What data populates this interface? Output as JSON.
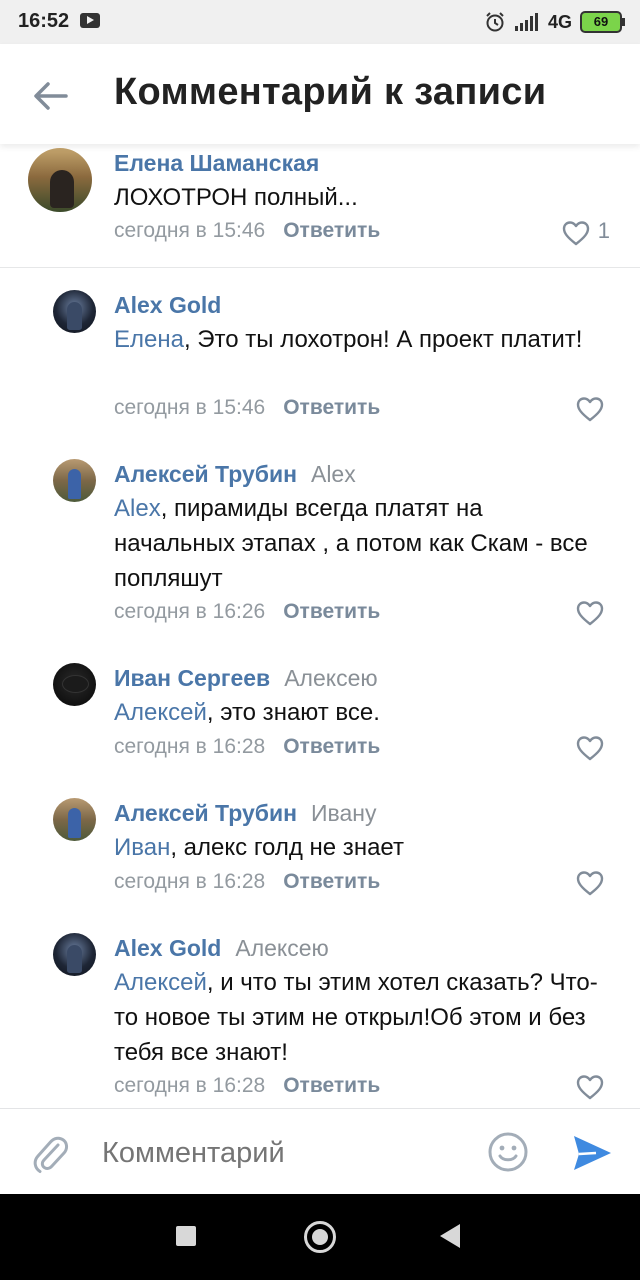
{
  "status_bar": {
    "time": "16:52",
    "network": "4G",
    "battery": "69"
  },
  "header": {
    "title": "Комментарий к записи"
  },
  "comments": [
    {
      "author": "Елена Шаманская",
      "text": "ЛОХОТРОН полный...",
      "time": "сегодня в 15:46",
      "reply_label": "Ответить",
      "likes": "1"
    },
    {
      "author": "Alex Gold",
      "mention": "Елена",
      "text": ", Это ты лохотрон! А проект платит!",
      "time": "сегодня в 15:46",
      "reply_label": "Ответить"
    },
    {
      "author": "Алексей Трубин",
      "reply_to": "Alex",
      "mention": "Alex",
      "text": ", пирамиды всегда платят на начальных этапах , а потом как Скам - все попляшут",
      "time": "сегодня в 16:26",
      "reply_label": "Ответить"
    },
    {
      "author": "Иван Сергеев",
      "reply_to": "Алексею",
      "mention": "Алексей",
      "text": ", это знают все.",
      "time": "сегодня в 16:28",
      "reply_label": "Ответить"
    },
    {
      "author": "Алексей Трубин",
      "reply_to": "Ивану",
      "mention": "Иван",
      "text": ", алекс голд не знает",
      "time": "сегодня в 16:28",
      "reply_label": "Ответить"
    },
    {
      "author": "Alex Gold",
      "reply_to": "Алексею",
      "mention": "Алексей",
      "text": ", и что ты этим хотел сказать? Что-то новое ты этим не открыл!Об этом и без тебя все знают!",
      "time": "сегодня в 16:28",
      "reply_label": "Ответить"
    }
  ],
  "composer": {
    "placeholder": "Комментарий"
  },
  "icons": {
    "back": "arrow-left-icon",
    "like": "heart-outline-icon",
    "attach": "paperclip-icon",
    "emoji": "smile-icon",
    "send": "send-icon"
  },
  "colors": {
    "accent": "#4a76a8",
    "secondary": "#939aa0",
    "send": "#3f8ae0"
  }
}
